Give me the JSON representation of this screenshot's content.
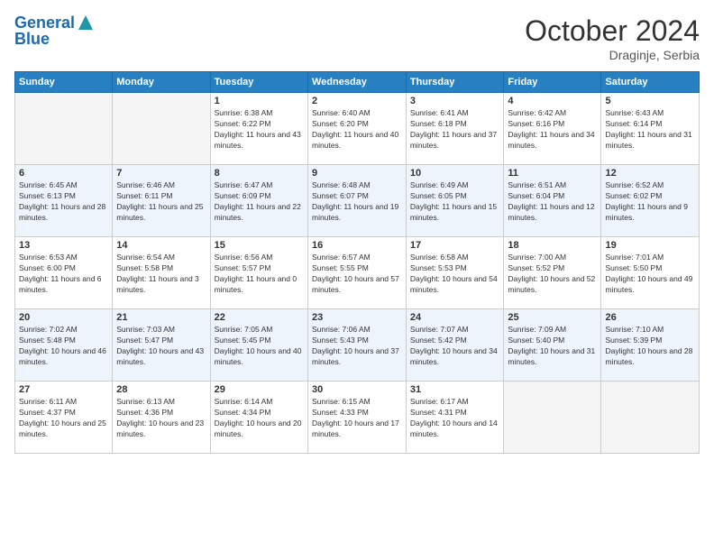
{
  "header": {
    "logo_line1": "General",
    "logo_line2": "Blue",
    "month": "October 2024",
    "location": "Draginje, Serbia"
  },
  "days_header": [
    "Sunday",
    "Monday",
    "Tuesday",
    "Wednesday",
    "Thursday",
    "Friday",
    "Saturday"
  ],
  "weeks": [
    [
      {
        "day": "",
        "sunrise": "",
        "sunset": "",
        "daylight": ""
      },
      {
        "day": "",
        "sunrise": "",
        "sunset": "",
        "daylight": ""
      },
      {
        "day": "1",
        "sunrise": "Sunrise: 6:38 AM",
        "sunset": "Sunset: 6:22 PM",
        "daylight": "Daylight: 11 hours and 43 minutes."
      },
      {
        "day": "2",
        "sunrise": "Sunrise: 6:40 AM",
        "sunset": "Sunset: 6:20 PM",
        "daylight": "Daylight: 11 hours and 40 minutes."
      },
      {
        "day": "3",
        "sunrise": "Sunrise: 6:41 AM",
        "sunset": "Sunset: 6:18 PM",
        "daylight": "Daylight: 11 hours and 37 minutes."
      },
      {
        "day": "4",
        "sunrise": "Sunrise: 6:42 AM",
        "sunset": "Sunset: 6:16 PM",
        "daylight": "Daylight: 11 hours and 34 minutes."
      },
      {
        "day": "5",
        "sunrise": "Sunrise: 6:43 AM",
        "sunset": "Sunset: 6:14 PM",
        "daylight": "Daylight: 11 hours and 31 minutes."
      }
    ],
    [
      {
        "day": "6",
        "sunrise": "Sunrise: 6:45 AM",
        "sunset": "Sunset: 6:13 PM",
        "daylight": "Daylight: 11 hours and 28 minutes."
      },
      {
        "day": "7",
        "sunrise": "Sunrise: 6:46 AM",
        "sunset": "Sunset: 6:11 PM",
        "daylight": "Daylight: 11 hours and 25 minutes."
      },
      {
        "day": "8",
        "sunrise": "Sunrise: 6:47 AM",
        "sunset": "Sunset: 6:09 PM",
        "daylight": "Daylight: 11 hours and 22 minutes."
      },
      {
        "day": "9",
        "sunrise": "Sunrise: 6:48 AM",
        "sunset": "Sunset: 6:07 PM",
        "daylight": "Daylight: 11 hours and 19 minutes."
      },
      {
        "day": "10",
        "sunrise": "Sunrise: 6:49 AM",
        "sunset": "Sunset: 6:05 PM",
        "daylight": "Daylight: 11 hours and 15 minutes."
      },
      {
        "day": "11",
        "sunrise": "Sunrise: 6:51 AM",
        "sunset": "Sunset: 6:04 PM",
        "daylight": "Daylight: 11 hours and 12 minutes."
      },
      {
        "day": "12",
        "sunrise": "Sunrise: 6:52 AM",
        "sunset": "Sunset: 6:02 PM",
        "daylight": "Daylight: 11 hours and 9 minutes."
      }
    ],
    [
      {
        "day": "13",
        "sunrise": "Sunrise: 6:53 AM",
        "sunset": "Sunset: 6:00 PM",
        "daylight": "Daylight: 11 hours and 6 minutes."
      },
      {
        "day": "14",
        "sunrise": "Sunrise: 6:54 AM",
        "sunset": "Sunset: 5:58 PM",
        "daylight": "Daylight: 11 hours and 3 minutes."
      },
      {
        "day": "15",
        "sunrise": "Sunrise: 6:56 AM",
        "sunset": "Sunset: 5:57 PM",
        "daylight": "Daylight: 11 hours and 0 minutes."
      },
      {
        "day": "16",
        "sunrise": "Sunrise: 6:57 AM",
        "sunset": "Sunset: 5:55 PM",
        "daylight": "Daylight: 10 hours and 57 minutes."
      },
      {
        "day": "17",
        "sunrise": "Sunrise: 6:58 AM",
        "sunset": "Sunset: 5:53 PM",
        "daylight": "Daylight: 10 hours and 54 minutes."
      },
      {
        "day": "18",
        "sunrise": "Sunrise: 7:00 AM",
        "sunset": "Sunset: 5:52 PM",
        "daylight": "Daylight: 10 hours and 52 minutes."
      },
      {
        "day": "19",
        "sunrise": "Sunrise: 7:01 AM",
        "sunset": "Sunset: 5:50 PM",
        "daylight": "Daylight: 10 hours and 49 minutes."
      }
    ],
    [
      {
        "day": "20",
        "sunrise": "Sunrise: 7:02 AM",
        "sunset": "Sunset: 5:48 PM",
        "daylight": "Daylight: 10 hours and 46 minutes."
      },
      {
        "day": "21",
        "sunrise": "Sunrise: 7:03 AM",
        "sunset": "Sunset: 5:47 PM",
        "daylight": "Daylight: 10 hours and 43 minutes."
      },
      {
        "day": "22",
        "sunrise": "Sunrise: 7:05 AM",
        "sunset": "Sunset: 5:45 PM",
        "daylight": "Daylight: 10 hours and 40 minutes."
      },
      {
        "day": "23",
        "sunrise": "Sunrise: 7:06 AM",
        "sunset": "Sunset: 5:43 PM",
        "daylight": "Daylight: 10 hours and 37 minutes."
      },
      {
        "day": "24",
        "sunrise": "Sunrise: 7:07 AM",
        "sunset": "Sunset: 5:42 PM",
        "daylight": "Daylight: 10 hours and 34 minutes."
      },
      {
        "day": "25",
        "sunrise": "Sunrise: 7:09 AM",
        "sunset": "Sunset: 5:40 PM",
        "daylight": "Daylight: 10 hours and 31 minutes."
      },
      {
        "day": "26",
        "sunrise": "Sunrise: 7:10 AM",
        "sunset": "Sunset: 5:39 PM",
        "daylight": "Daylight: 10 hours and 28 minutes."
      }
    ],
    [
      {
        "day": "27",
        "sunrise": "Sunrise: 6:11 AM",
        "sunset": "Sunset: 4:37 PM",
        "daylight": "Daylight: 10 hours and 25 minutes."
      },
      {
        "day": "28",
        "sunrise": "Sunrise: 6:13 AM",
        "sunset": "Sunset: 4:36 PM",
        "daylight": "Daylight: 10 hours and 23 minutes."
      },
      {
        "day": "29",
        "sunrise": "Sunrise: 6:14 AM",
        "sunset": "Sunset: 4:34 PM",
        "daylight": "Daylight: 10 hours and 20 minutes."
      },
      {
        "day": "30",
        "sunrise": "Sunrise: 6:15 AM",
        "sunset": "Sunset: 4:33 PM",
        "daylight": "Daylight: 10 hours and 17 minutes."
      },
      {
        "day": "31",
        "sunrise": "Sunrise: 6:17 AM",
        "sunset": "Sunset: 4:31 PM",
        "daylight": "Daylight: 10 hours and 14 minutes."
      },
      {
        "day": "",
        "sunrise": "",
        "sunset": "",
        "daylight": ""
      },
      {
        "day": "",
        "sunrise": "",
        "sunset": "",
        "daylight": ""
      }
    ]
  ]
}
